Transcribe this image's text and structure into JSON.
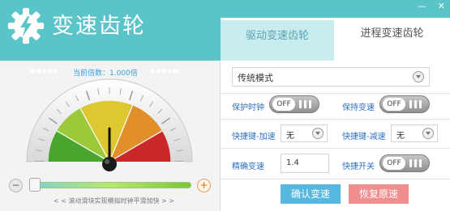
{
  "app": {
    "title": "变速齿轮",
    "logo_icon": "gear-lightning-icon"
  },
  "window": {
    "minimize_label": "—",
    "close_label": "✕"
  },
  "tabs": [
    {
      "label": "驱动变速齿轮",
      "active": true
    },
    {
      "label": "进程变速齿轮",
      "active": false
    }
  ],
  "left": {
    "arrows_left": "◀◀◀◀◀",
    "arrows_right": "▶▶▶▶▶",
    "rate_text": "当前倍数：1.000倍",
    "minus_label": "−",
    "plus_label": "+",
    "hint": "< < 滚动滑块实现模拟时钟平滑加快 > >",
    "speed_fraction": 0.0
  },
  "right": {
    "mode": "传统模式",
    "protect_clock": {
      "label": "保护时钟",
      "state": "OFF"
    },
    "keep_speed": {
      "label": "保持变速",
      "state": "OFF"
    },
    "hotkey_up": {
      "label": "快捷键-加速",
      "value": "无"
    },
    "hotkey_down": {
      "label": "快捷键-减速",
      "value": "无"
    },
    "precise": {
      "label": "精确变速",
      "value": "1.4"
    },
    "hotkey_switch": {
      "label": "快捷开关",
      "state": "OFF"
    },
    "confirm_label": "确认变速",
    "restore_label": "恢复原速"
  },
  "colors": {
    "header": "#5bc4c8",
    "tab_active_bg": "#c9ecef",
    "accent_blue": "#56b8e0",
    "accent_red": "#ef8d8f",
    "gauge_green": "#4aa52e",
    "gauge_lime": "#9bc93a",
    "gauge_yellow": "#ddc832",
    "gauge_orange": "#e08f2a",
    "gauge_red": "#c8282a"
  }
}
